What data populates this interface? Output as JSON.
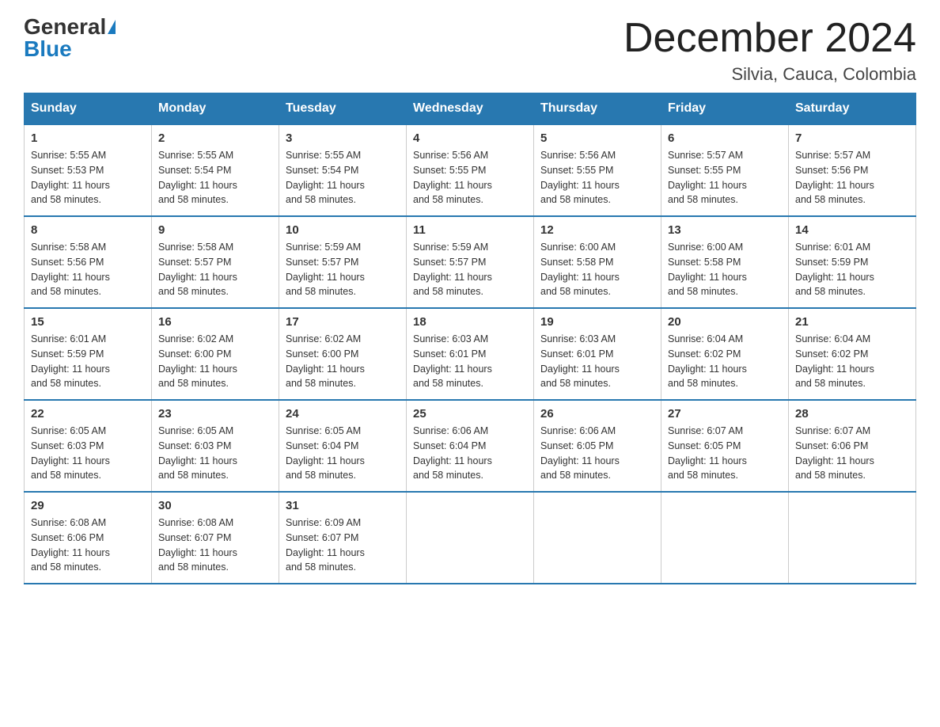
{
  "header": {
    "logo_general": "General",
    "logo_blue": "Blue",
    "month_title": "December 2024",
    "location": "Silvia, Cauca, Colombia"
  },
  "days_of_week": [
    "Sunday",
    "Monday",
    "Tuesday",
    "Wednesday",
    "Thursday",
    "Friday",
    "Saturday"
  ],
  "weeks": [
    [
      {
        "day": "1",
        "sunrise": "5:55 AM",
        "sunset": "5:53 PM",
        "daylight": "11 hours and 58 minutes."
      },
      {
        "day": "2",
        "sunrise": "5:55 AM",
        "sunset": "5:54 PM",
        "daylight": "11 hours and 58 minutes."
      },
      {
        "day": "3",
        "sunrise": "5:55 AM",
        "sunset": "5:54 PM",
        "daylight": "11 hours and 58 minutes."
      },
      {
        "day": "4",
        "sunrise": "5:56 AM",
        "sunset": "5:55 PM",
        "daylight": "11 hours and 58 minutes."
      },
      {
        "day": "5",
        "sunrise": "5:56 AM",
        "sunset": "5:55 PM",
        "daylight": "11 hours and 58 minutes."
      },
      {
        "day": "6",
        "sunrise": "5:57 AM",
        "sunset": "5:55 PM",
        "daylight": "11 hours and 58 minutes."
      },
      {
        "day": "7",
        "sunrise": "5:57 AM",
        "sunset": "5:56 PM",
        "daylight": "11 hours and 58 minutes."
      }
    ],
    [
      {
        "day": "8",
        "sunrise": "5:58 AM",
        "sunset": "5:56 PM",
        "daylight": "11 hours and 58 minutes."
      },
      {
        "day": "9",
        "sunrise": "5:58 AM",
        "sunset": "5:57 PM",
        "daylight": "11 hours and 58 minutes."
      },
      {
        "day": "10",
        "sunrise": "5:59 AM",
        "sunset": "5:57 PM",
        "daylight": "11 hours and 58 minutes."
      },
      {
        "day": "11",
        "sunrise": "5:59 AM",
        "sunset": "5:57 PM",
        "daylight": "11 hours and 58 minutes."
      },
      {
        "day": "12",
        "sunrise": "6:00 AM",
        "sunset": "5:58 PM",
        "daylight": "11 hours and 58 minutes."
      },
      {
        "day": "13",
        "sunrise": "6:00 AM",
        "sunset": "5:58 PM",
        "daylight": "11 hours and 58 minutes."
      },
      {
        "day": "14",
        "sunrise": "6:01 AM",
        "sunset": "5:59 PM",
        "daylight": "11 hours and 58 minutes."
      }
    ],
    [
      {
        "day": "15",
        "sunrise": "6:01 AM",
        "sunset": "5:59 PM",
        "daylight": "11 hours and 58 minutes."
      },
      {
        "day": "16",
        "sunrise": "6:02 AM",
        "sunset": "6:00 PM",
        "daylight": "11 hours and 58 minutes."
      },
      {
        "day": "17",
        "sunrise": "6:02 AM",
        "sunset": "6:00 PM",
        "daylight": "11 hours and 58 minutes."
      },
      {
        "day": "18",
        "sunrise": "6:03 AM",
        "sunset": "6:01 PM",
        "daylight": "11 hours and 58 minutes."
      },
      {
        "day": "19",
        "sunrise": "6:03 AM",
        "sunset": "6:01 PM",
        "daylight": "11 hours and 58 minutes."
      },
      {
        "day": "20",
        "sunrise": "6:04 AM",
        "sunset": "6:02 PM",
        "daylight": "11 hours and 58 minutes."
      },
      {
        "day": "21",
        "sunrise": "6:04 AM",
        "sunset": "6:02 PM",
        "daylight": "11 hours and 58 minutes."
      }
    ],
    [
      {
        "day": "22",
        "sunrise": "6:05 AM",
        "sunset": "6:03 PM",
        "daylight": "11 hours and 58 minutes."
      },
      {
        "day": "23",
        "sunrise": "6:05 AM",
        "sunset": "6:03 PM",
        "daylight": "11 hours and 58 minutes."
      },
      {
        "day": "24",
        "sunrise": "6:05 AM",
        "sunset": "6:04 PM",
        "daylight": "11 hours and 58 minutes."
      },
      {
        "day": "25",
        "sunrise": "6:06 AM",
        "sunset": "6:04 PM",
        "daylight": "11 hours and 58 minutes."
      },
      {
        "day": "26",
        "sunrise": "6:06 AM",
        "sunset": "6:05 PM",
        "daylight": "11 hours and 58 minutes."
      },
      {
        "day": "27",
        "sunrise": "6:07 AM",
        "sunset": "6:05 PM",
        "daylight": "11 hours and 58 minutes."
      },
      {
        "day": "28",
        "sunrise": "6:07 AM",
        "sunset": "6:06 PM",
        "daylight": "11 hours and 58 minutes."
      }
    ],
    [
      {
        "day": "29",
        "sunrise": "6:08 AM",
        "sunset": "6:06 PM",
        "daylight": "11 hours and 58 minutes."
      },
      {
        "day": "30",
        "sunrise": "6:08 AM",
        "sunset": "6:07 PM",
        "daylight": "11 hours and 58 minutes."
      },
      {
        "day": "31",
        "sunrise": "6:09 AM",
        "sunset": "6:07 PM",
        "daylight": "11 hours and 58 minutes."
      },
      null,
      null,
      null,
      null
    ]
  ],
  "labels": {
    "sunrise": "Sunrise:",
    "sunset": "Sunset:",
    "daylight": "Daylight:"
  }
}
